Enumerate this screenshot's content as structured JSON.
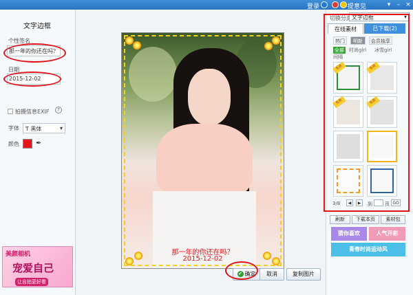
{
  "topbar": {
    "login": "登录",
    "feedback": "提意见"
  },
  "left": {
    "title": "文字边框",
    "signature_label": "个性签名",
    "signature_value": "那一年的你还在吗？",
    "date_label": "日期",
    "date_value": "2015-12-02",
    "exif_label": "拍摄信息EXIF",
    "help_mark": "?",
    "font_label": "字体",
    "font_value": "黑体",
    "color_label": "颜色",
    "text_color": "#e8141b",
    "ad": {
      "brand": "美颜相机",
      "slogan": "宠爱自己",
      "sub": "让自拍更好看"
    }
  },
  "canvas": {
    "caption_line1": "那一年的你还在吗？",
    "caption_line2": "2015-12-02",
    "ok_label": "确定",
    "cancel_label": "取消",
    "reset_label": "复制图片"
  },
  "right": {
    "category_label": "切换分类",
    "category_value": "文字边框",
    "tabs": [
      {
        "label": "在线素材"
      },
      {
        "label": "已下载(2)"
      }
    ],
    "chips": [
      {
        "label": "热门"
      },
      {
        "label": "明新"
      },
      {
        "label": "会员独享"
      }
    ],
    "subchips": [
      {
        "label": "全部"
      },
      {
        "label": "时尚girl"
      },
      {
        "label": "冰雪girl"
      },
      {
        "label": "间隔"
      }
    ],
    "thumb_tag": "免费",
    "page_label": "3/8",
    "goto_label": "到",
    "page_unit": "页",
    "go_label": "GO",
    "tools": [
      {
        "label": "刷新"
      },
      {
        "label": "下载本页"
      },
      {
        "label": "素材包"
      }
    ],
    "promos": [
      {
        "label": "猜你喜欢"
      },
      {
        "label": "人气开彩"
      },
      {
        "label": "青春时尚运动风"
      }
    ]
  }
}
